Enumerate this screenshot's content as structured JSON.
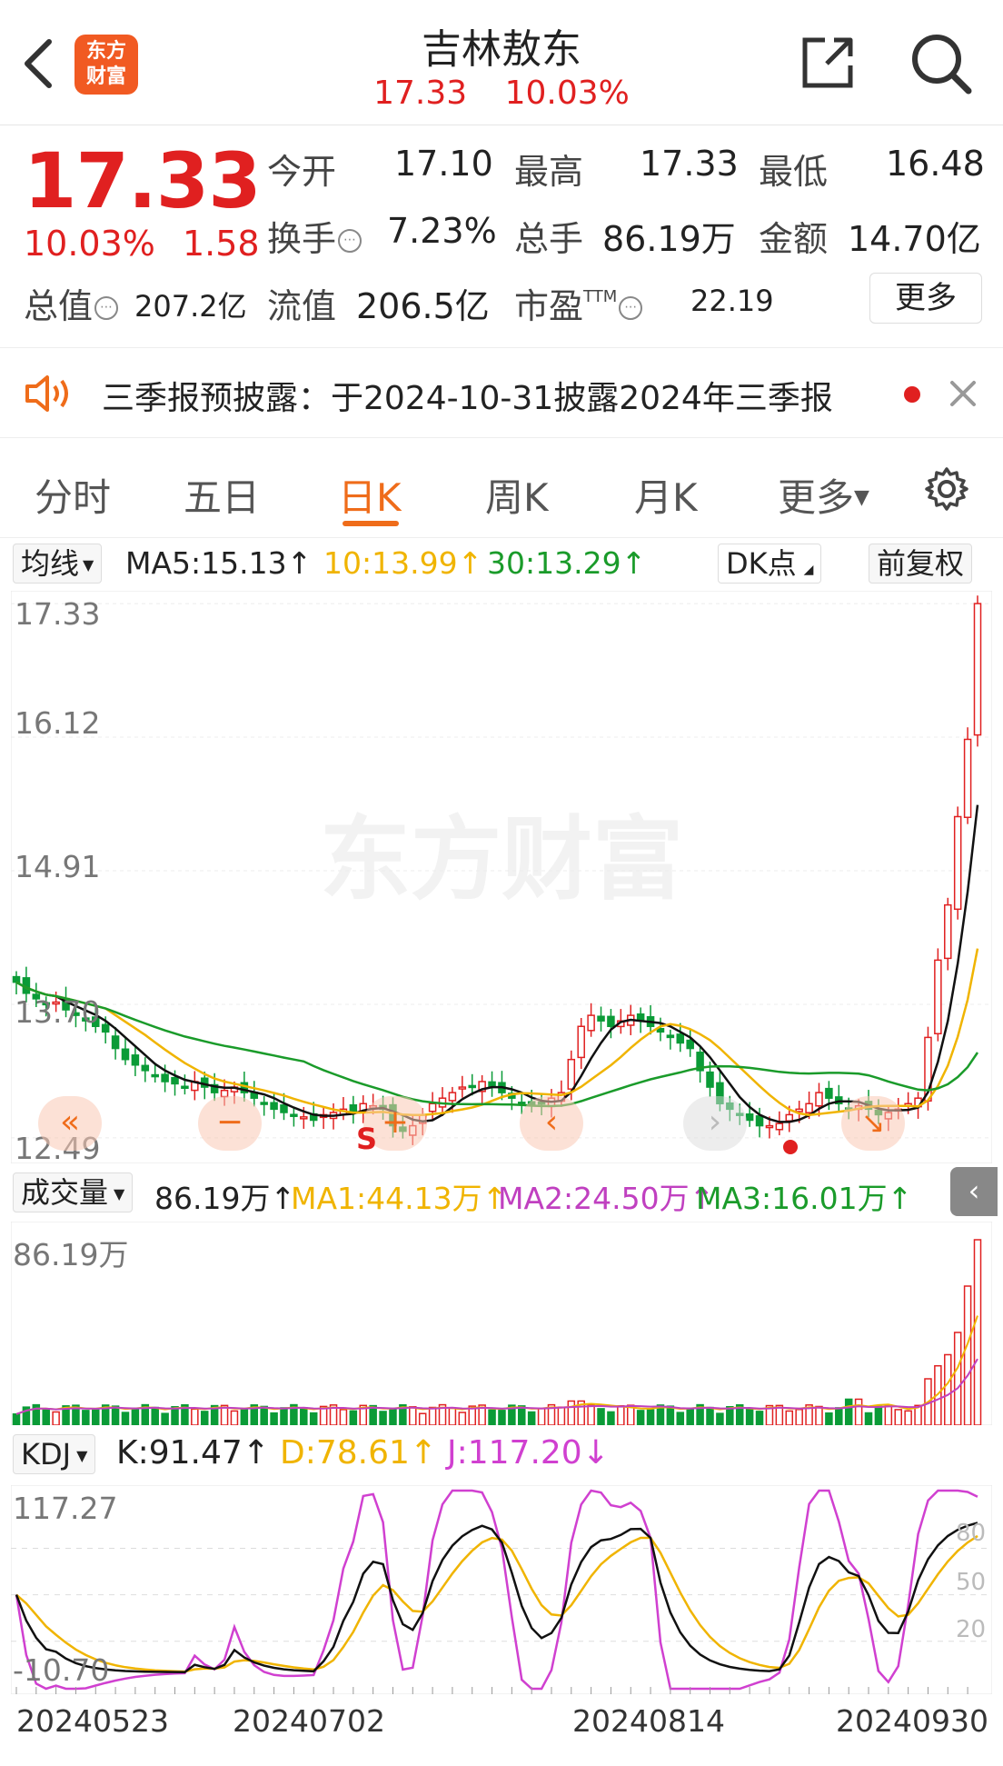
{
  "header": {
    "logo_line1": "东方",
    "logo_line2": "财富",
    "title": "吉林敖东",
    "price": "17.33",
    "change_pct": "10.03%"
  },
  "quote": {
    "price": "17.33",
    "change_pct": "10.03%",
    "change_amt": "1.58",
    "open_label": "今开",
    "open": "17.10",
    "high_label": "最高",
    "high": "17.33",
    "low_label": "最低",
    "low": "16.48",
    "turnover_label": "换手",
    "turnover": "7.23%",
    "volume_label": "总手",
    "volume": "86.19万",
    "amount_label": "金额",
    "amount": "14.70亿",
    "mktcap_label": "总值",
    "mktcap": "207.2亿",
    "float_label": "流值",
    "float": "206.5亿",
    "pe_label": "市盈",
    "pe_sup": "TTM",
    "pe": "22.19",
    "more_label": "更多"
  },
  "notice": {
    "text": "三季报预披露：于2024-10-31披露2024年三季报"
  },
  "tabs": [
    "分时",
    "五日",
    "日K",
    "周K",
    "月K",
    "更多"
  ],
  "active_tab": "日K",
  "kline": {
    "ma_selector": "均线",
    "ma5": "MA5:15.13↑",
    "ma10": "10:13.99↑",
    "ma30": "30:13.29↑",
    "dk_label": "DK点",
    "adjust_label": "前复权",
    "watermark": "东方财富",
    "y_labels": [
      "17.33",
      "16.12",
      "14.91",
      "13.70",
      "12.49"
    ],
    "marker_s": "S"
  },
  "volume": {
    "selector": "成交量",
    "value": "86.19万↑",
    "ma1": "MA1:44.13万↑",
    "ma2": "MA2:24.50万↑",
    "ma3": "MA3:16.01万↑",
    "y_label": "86.19万"
  },
  "kdj": {
    "selector": "KDJ",
    "k": "K:91.47↑",
    "d": "D:78.61↑",
    "j": "J:117.20↓",
    "y_top": "117.27",
    "y_bottom": "-10.70",
    "ref_levels": [
      "80",
      "50",
      "20"
    ]
  },
  "dates": [
    "20240523",
    "20240702",
    "20240814",
    "20240930"
  ],
  "colors": {
    "up": "#e02020",
    "down": "#0a9b37",
    "accent": "#ef6c1a",
    "ma5": "#111111",
    "ma10": "#f0b400",
    "ma30": "#1a9b2a",
    "ma2": "#c040c0",
    "k": "#111111",
    "d": "#f0b400",
    "j": "#d040d0"
  },
  "chart_data": {
    "type": "candlestick",
    "title": "吉林敖东",
    "ylim": [
      12.49,
      17.33
    ],
    "last_close": 17.33,
    "closes": [
      13.9,
      13.8,
      13.75,
      13.7,
      13.72,
      13.65,
      13.6,
      13.55,
      13.5,
      13.45,
      13.3,
      13.2,
      13.15,
      13.1,
      13.05,
      13.0,
      12.98,
      12.95,
      13.0,
      12.95,
      12.9,
      12.92,
      12.95,
      12.9,
      12.85,
      12.8,
      12.75,
      12.72,
      12.7,
      12.68,
      12.65,
      12.7,
      12.72,
      12.75,
      12.72,
      12.8,
      12.78,
      12.75,
      12.6,
      12.55,
      12.6,
      12.7,
      12.8,
      12.85,
      12.9,
      12.95,
      12.95,
      13.0,
      12.95,
      12.9,
      12.85,
      12.8,
      12.78,
      12.8,
      12.85,
      12.9,
      13.2,
      13.5,
      13.6,
      13.55,
      13.5,
      13.55,
      13.6,
      13.55,
      13.5,
      13.45,
      13.4,
      13.35,
      13.3,
      13.1,
      12.95,
      12.8,
      12.75,
      12.7,
      12.65,
      12.6,
      12.6,
      12.62,
      12.7,
      12.75,
      12.8,
      12.9,
      12.85,
      12.8,
      12.75,
      12.78,
      12.75,
      12.7,
      12.72,
      12.75,
      12.8,
      12.85,
      13.4,
      14.1,
      14.6,
      15.4,
      16.1,
      17.33
    ]
  }
}
